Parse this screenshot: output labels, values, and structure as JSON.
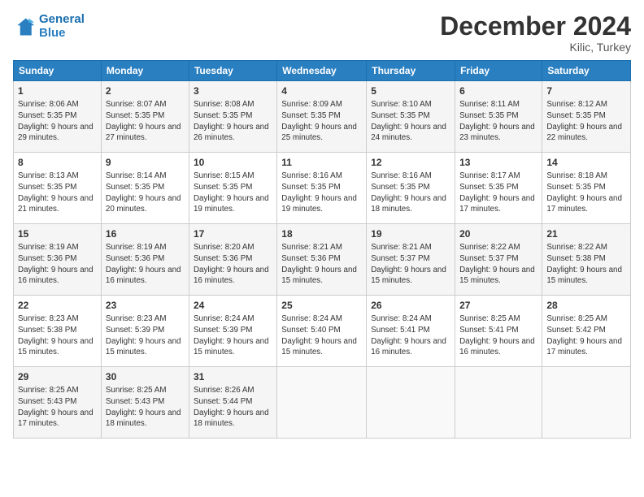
{
  "header": {
    "logo_line1": "General",
    "logo_line2": "Blue",
    "month_title": "December 2024",
    "location": "Kilic, Turkey"
  },
  "days_of_week": [
    "Sunday",
    "Monday",
    "Tuesday",
    "Wednesday",
    "Thursday",
    "Friday",
    "Saturday"
  ],
  "weeks": [
    [
      {
        "day": "1",
        "sunrise": "8:06 AM",
        "sunset": "5:35 PM",
        "daylight": "9 hours and 29 minutes."
      },
      {
        "day": "2",
        "sunrise": "8:07 AM",
        "sunset": "5:35 PM",
        "daylight": "9 hours and 27 minutes."
      },
      {
        "day": "3",
        "sunrise": "8:08 AM",
        "sunset": "5:35 PM",
        "daylight": "9 hours and 26 minutes."
      },
      {
        "day": "4",
        "sunrise": "8:09 AM",
        "sunset": "5:35 PM",
        "daylight": "9 hours and 25 minutes."
      },
      {
        "day": "5",
        "sunrise": "8:10 AM",
        "sunset": "5:35 PM",
        "daylight": "9 hours and 24 minutes."
      },
      {
        "day": "6",
        "sunrise": "8:11 AM",
        "sunset": "5:35 PM",
        "daylight": "9 hours and 23 minutes."
      },
      {
        "day": "7",
        "sunrise": "8:12 AM",
        "sunset": "5:35 PM",
        "daylight": "9 hours and 22 minutes."
      }
    ],
    [
      {
        "day": "8",
        "sunrise": "8:13 AM",
        "sunset": "5:35 PM",
        "daylight": "9 hours and 21 minutes."
      },
      {
        "day": "9",
        "sunrise": "8:14 AM",
        "sunset": "5:35 PM",
        "daylight": "9 hours and 20 minutes."
      },
      {
        "day": "10",
        "sunrise": "8:15 AM",
        "sunset": "5:35 PM",
        "daylight": "9 hours and 19 minutes."
      },
      {
        "day": "11",
        "sunrise": "8:16 AM",
        "sunset": "5:35 PM",
        "daylight": "9 hours and 19 minutes."
      },
      {
        "day": "12",
        "sunrise": "8:16 AM",
        "sunset": "5:35 PM",
        "daylight": "9 hours and 18 minutes."
      },
      {
        "day": "13",
        "sunrise": "8:17 AM",
        "sunset": "5:35 PM",
        "daylight": "9 hours and 17 minutes."
      },
      {
        "day": "14",
        "sunrise": "8:18 AM",
        "sunset": "5:35 PM",
        "daylight": "9 hours and 17 minutes."
      }
    ],
    [
      {
        "day": "15",
        "sunrise": "8:19 AM",
        "sunset": "5:36 PM",
        "daylight": "9 hours and 16 minutes."
      },
      {
        "day": "16",
        "sunrise": "8:19 AM",
        "sunset": "5:36 PM",
        "daylight": "9 hours and 16 minutes."
      },
      {
        "day": "17",
        "sunrise": "8:20 AM",
        "sunset": "5:36 PM",
        "daylight": "9 hours and 16 minutes."
      },
      {
        "day": "18",
        "sunrise": "8:21 AM",
        "sunset": "5:36 PM",
        "daylight": "9 hours and 15 minutes."
      },
      {
        "day": "19",
        "sunrise": "8:21 AM",
        "sunset": "5:37 PM",
        "daylight": "9 hours and 15 minutes."
      },
      {
        "day": "20",
        "sunrise": "8:22 AM",
        "sunset": "5:37 PM",
        "daylight": "9 hours and 15 minutes."
      },
      {
        "day": "21",
        "sunrise": "8:22 AM",
        "sunset": "5:38 PM",
        "daylight": "9 hours and 15 minutes."
      }
    ],
    [
      {
        "day": "22",
        "sunrise": "8:23 AM",
        "sunset": "5:38 PM",
        "daylight": "9 hours and 15 minutes."
      },
      {
        "day": "23",
        "sunrise": "8:23 AM",
        "sunset": "5:39 PM",
        "daylight": "9 hours and 15 minutes."
      },
      {
        "day": "24",
        "sunrise": "8:24 AM",
        "sunset": "5:39 PM",
        "daylight": "9 hours and 15 minutes."
      },
      {
        "day": "25",
        "sunrise": "8:24 AM",
        "sunset": "5:40 PM",
        "daylight": "9 hours and 15 minutes."
      },
      {
        "day": "26",
        "sunrise": "8:24 AM",
        "sunset": "5:41 PM",
        "daylight": "9 hours and 16 minutes."
      },
      {
        "day": "27",
        "sunrise": "8:25 AM",
        "sunset": "5:41 PM",
        "daylight": "9 hours and 16 minutes."
      },
      {
        "day": "28",
        "sunrise": "8:25 AM",
        "sunset": "5:42 PM",
        "daylight": "9 hours and 17 minutes."
      }
    ],
    [
      {
        "day": "29",
        "sunrise": "8:25 AM",
        "sunset": "5:43 PM",
        "daylight": "9 hours and 17 minutes."
      },
      {
        "day": "30",
        "sunrise": "8:25 AM",
        "sunset": "5:43 PM",
        "daylight": "9 hours and 18 minutes."
      },
      {
        "day": "31",
        "sunrise": "8:26 AM",
        "sunset": "5:44 PM",
        "daylight": "9 hours and 18 minutes."
      },
      null,
      null,
      null,
      null
    ]
  ]
}
